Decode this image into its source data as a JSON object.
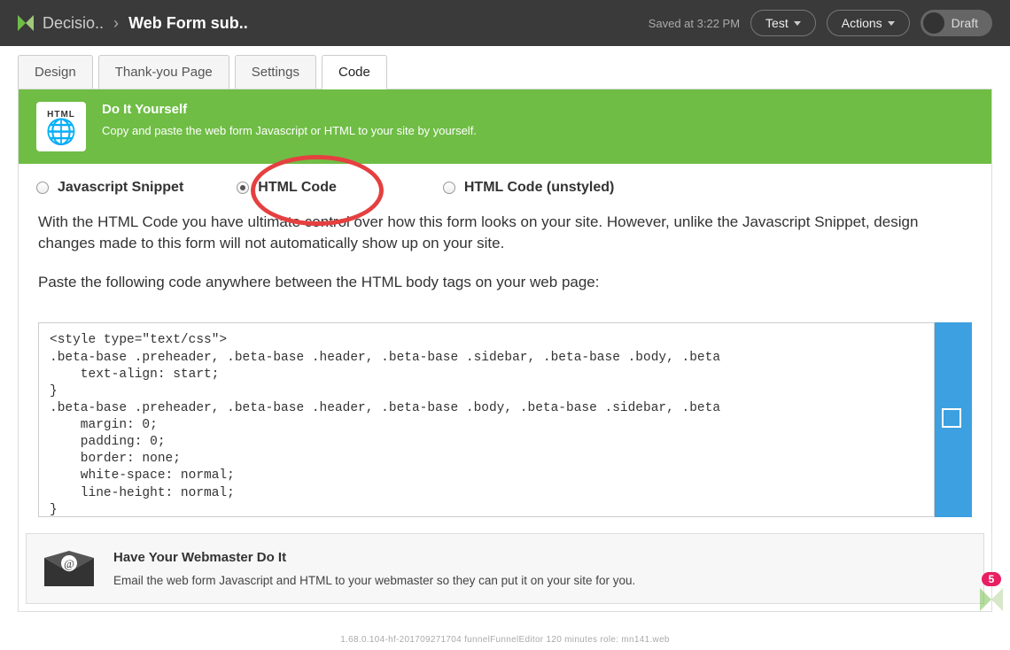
{
  "header": {
    "breadcrumb_root": "Decisio..",
    "breadcrumb_sep": "›",
    "breadcrumb_current": "Web Form sub..",
    "saved_text": "Saved at 3:22 PM",
    "test_label": "Test",
    "actions_label": "Actions",
    "draft_label": "Draft"
  },
  "tabs": {
    "design": "Design",
    "thankyou": "Thank-you Page",
    "settings": "Settings",
    "code": "Code"
  },
  "banner": {
    "title": "Do It Yourself",
    "sub": "Copy and paste the web form Javascript or HTML to your site by yourself.",
    "stamp_top": "HTML",
    "stamp_globe": "🌐"
  },
  "radios": {
    "js": "Javascript Snippet",
    "html": "HTML Code",
    "html_unstyled": "HTML Code (unstyled)"
  },
  "desc": {
    "p1": "With the HTML Code you have ultimate control over how this form looks on your site. However, unlike the Javascript Snippet, design changes made to this form will not automatically show up on your site.",
    "p2": "Paste the following code anywhere between the HTML body tags on your web page:"
  },
  "code_content": "<style type=\"text/css\">\n.beta-base .preheader, .beta-base .header, .beta-base .sidebar, .beta-base .body, .beta\n    text-align: start;\n}\n.beta-base .preheader, .beta-base .header, .beta-base .body, .beta-base .sidebar, .beta\n    margin: 0;\n    padding: 0;\n    border: none;\n    white-space: normal;\n    line-height: normal;\n}\n.beta-base .title, .beta-base .subtitle, .beta-base .text, .beta-base img {",
  "webmaster": {
    "title": "Have Your Webmaster Do It",
    "sub": "Email the web form Javascript and HTML to your webmaster so they can put it on your site for you."
  },
  "footer": {
    "text": "1.68.0.104-hf-201709271704     funnelFunnelEditor     120 minutes     role: mn141.web"
  },
  "badge": {
    "count": "5"
  }
}
